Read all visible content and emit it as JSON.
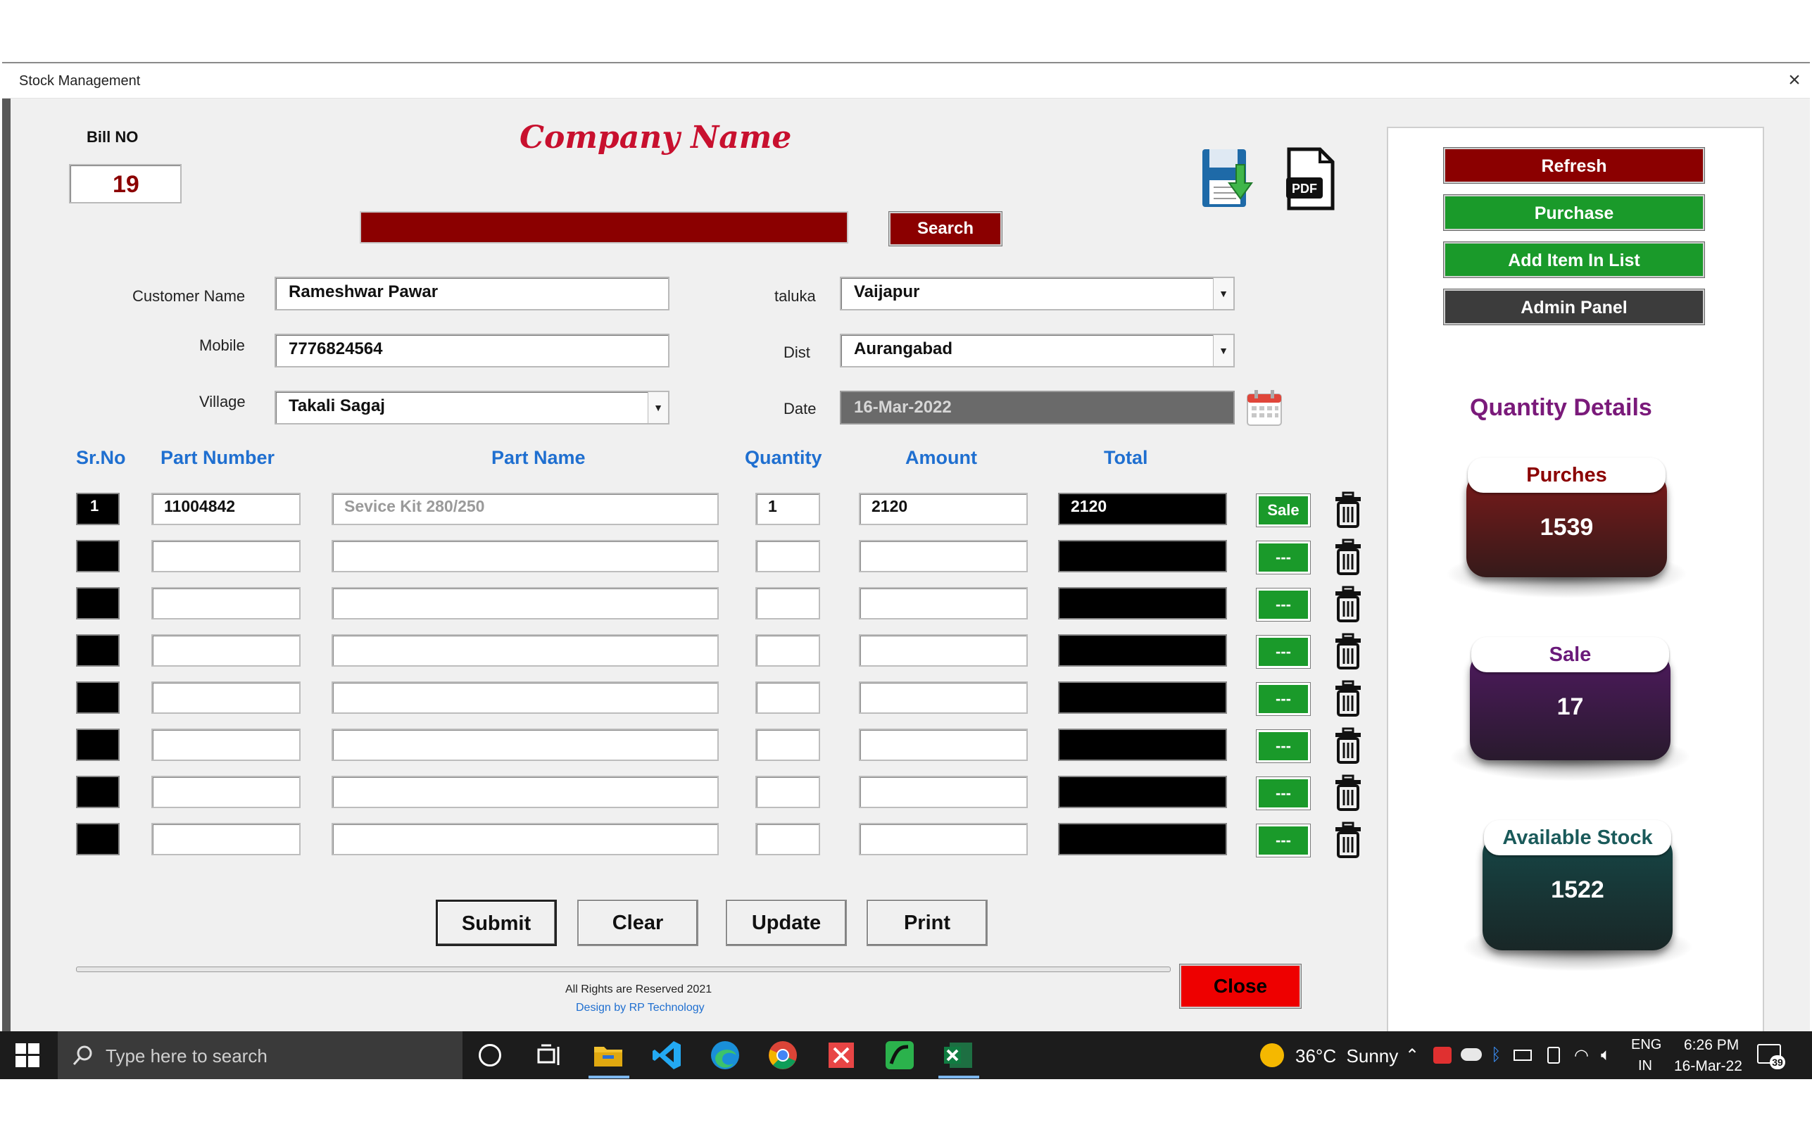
{
  "window": {
    "title": "Stock Management",
    "close_glyph": "×"
  },
  "bill": {
    "label": "Bill NO",
    "value": "19"
  },
  "company_name": "Company Name",
  "search": {
    "value": "",
    "button": "Search"
  },
  "icons": {
    "save": "save-download-icon",
    "pdf": "pdf-icon",
    "pdf_text": "PDF",
    "calendar": "calendar-icon",
    "trash": "trash-icon"
  },
  "form": {
    "customer_name": {
      "label": "Customer Name",
      "value": "Rameshwar Pawar"
    },
    "mobile": {
      "label": "Mobile",
      "value": "7776824564"
    },
    "village": {
      "label": "Village",
      "value": "Takali Sagaj"
    },
    "taluka": {
      "label": "taluka",
      "value": "Vaijapur"
    },
    "dist": {
      "label": "Dist",
      "value": "Aurangabad"
    },
    "date": {
      "label": "Date",
      "value": "16-Mar-2022"
    }
  },
  "table": {
    "headers": {
      "srno": "Sr.No",
      "part_number": "Part Number",
      "part_name": "Part Name",
      "quantity": "Quantity",
      "amount": "Amount",
      "total": "Total"
    },
    "rows": [
      {
        "srno": "1",
        "part_number": "11004842",
        "part_name": "Sevice Kit 280/250",
        "quantity": "1",
        "amount": "2120",
        "total": "2120",
        "action": "Sale"
      },
      {
        "srno": "",
        "part_number": "",
        "part_name": "",
        "quantity": "",
        "amount": "",
        "total": "",
        "action": "---"
      },
      {
        "srno": "",
        "part_number": "",
        "part_name": "",
        "quantity": "",
        "amount": "",
        "total": "",
        "action": "---"
      },
      {
        "srno": "",
        "part_number": "",
        "part_name": "",
        "quantity": "",
        "amount": "",
        "total": "",
        "action": "---"
      },
      {
        "srno": "",
        "part_number": "",
        "part_name": "",
        "quantity": "",
        "amount": "",
        "total": "",
        "action": "---"
      },
      {
        "srno": "",
        "part_number": "",
        "part_name": "",
        "quantity": "",
        "amount": "",
        "total": "",
        "action": "---"
      },
      {
        "srno": "",
        "part_number": "",
        "part_name": "",
        "quantity": "",
        "amount": "",
        "total": "",
        "action": "---"
      },
      {
        "srno": "",
        "part_number": "",
        "part_name": "",
        "quantity": "",
        "amount": "",
        "total": "",
        "action": "---"
      }
    ]
  },
  "actions": {
    "submit": "Submit",
    "clear": "Clear",
    "update": "Update",
    "print": "Print",
    "close": "Close"
  },
  "footer": {
    "rights": "All Rights are Reserved 2021",
    "design": "Design by RP Technology"
  },
  "sidebar": {
    "buttons": [
      {
        "label": "Refresh",
        "color": "#8b0000"
      },
      {
        "label": "Purchase",
        "color": "#1a9a2a"
      },
      {
        "label": "Add Item In List",
        "color": "#1a9a2a"
      },
      {
        "label": "Admin Panel",
        "color": "#3c3c3c"
      }
    ],
    "quantity_title": "Quantity Details",
    "cards": [
      {
        "label": "Purches",
        "value": "1539",
        "color": "#7a1a1a",
        "label_color": "#8b0000"
      },
      {
        "label": "Sale",
        "value": "17",
        "color": "#4e1a5e",
        "label_color": "#6a1a7a"
      },
      {
        "label": "Available Stock",
        "value": "1522",
        "color": "#164646",
        "label_color": "#1a5a5a"
      }
    ]
  },
  "taskbar": {
    "search_placeholder": "Type here to search",
    "weather": "36°C  Sunny",
    "lang": "ENG",
    "region": "IN",
    "time": "6:26 PM",
    "date": "16-Mar-22",
    "notifications": "39"
  }
}
